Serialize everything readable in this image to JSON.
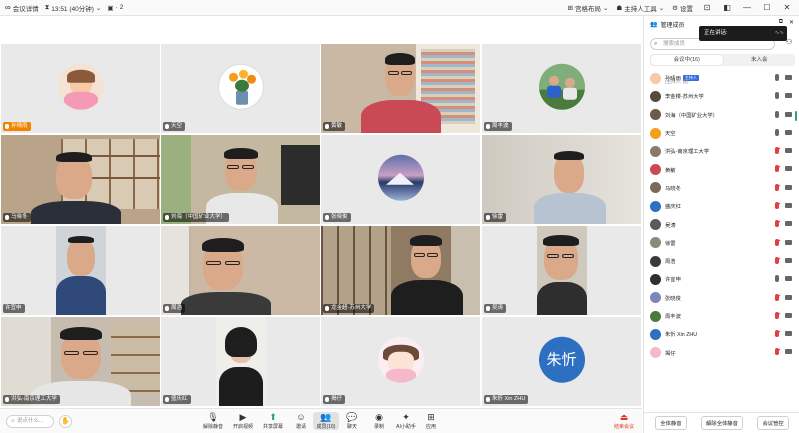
{
  "topbar": {
    "meeting_info": "会议详情",
    "timer": "13:51 (40分钟)",
    "participants_count": "2",
    "layout": "宫格布局",
    "host_ai": "主持人工具",
    "settings": "设置"
  },
  "tiles": [
    {
      "name": "孙晴雨"
    },
    {
      "name": "天空"
    },
    {
      "name": "黄敏"
    },
    {
      "name": "周丰波"
    },
    {
      "name": "马晓冬"
    },
    {
      "name": "刘海（中国矿业大学）"
    },
    {
      "name": "张晓俊"
    },
    {
      "name": "徐雷"
    },
    {
      "name": "许宜申"
    },
    {
      "name": "周浩"
    },
    {
      "name": "龙金超-苏州大学"
    },
    {
      "name": "吴涛"
    },
    {
      "name": "洪弘-南京理工大学"
    },
    {
      "name": "盛庆红"
    },
    {
      "name": "揭仔"
    },
    {
      "name": "朱忻 Xin ZHU"
    }
  ],
  "zhu_avatar_text": "朱忻",
  "bottombar": {
    "chat_placeholder": "说点什么...",
    "hand_icon": "✋",
    "tools": [
      {
        "label": "解除静音"
      },
      {
        "label": "开启视频"
      },
      {
        "label": "共享屏幕"
      },
      {
        "label": "邀请"
      },
      {
        "label": "成员(16)"
      },
      {
        "label": "聊天"
      },
      {
        "label": "录制"
      },
      {
        "label": "AI小助手"
      },
      {
        "label": "应用"
      }
    ],
    "leave": "结束会议"
  },
  "panel": {
    "title": "管理成员",
    "speaking": "正在讲话:",
    "search_placeholder": "搜索成员",
    "tab_in": "会议中(16)",
    "tab_out": "未入会",
    "host_badge": "主持人",
    "host_sub": "(主持人, 我)",
    "members": [
      {
        "name": "孙晴雨"
      },
      {
        "name": "李金楼-苏州大学"
      },
      {
        "name": "刘海（中国矿业大学）"
      },
      {
        "name": "天空"
      },
      {
        "name": "洪弘-南京理工大学"
      },
      {
        "name": "黄敏"
      },
      {
        "name": "马晓冬"
      },
      {
        "name": "盛庆红"
      },
      {
        "name": "吴涛"
      },
      {
        "name": "徐雷"
      },
      {
        "name": "周浩"
      },
      {
        "name": "许宜申"
      },
      {
        "name": "张晓俊"
      },
      {
        "name": "周丰波"
      },
      {
        "name": "朱忻 Xin ZHU"
      },
      {
        "name": "揭仔"
      }
    ],
    "mute_all": "全体静音",
    "unmute_all": "解除全体静音",
    "manage": "会议管控"
  }
}
